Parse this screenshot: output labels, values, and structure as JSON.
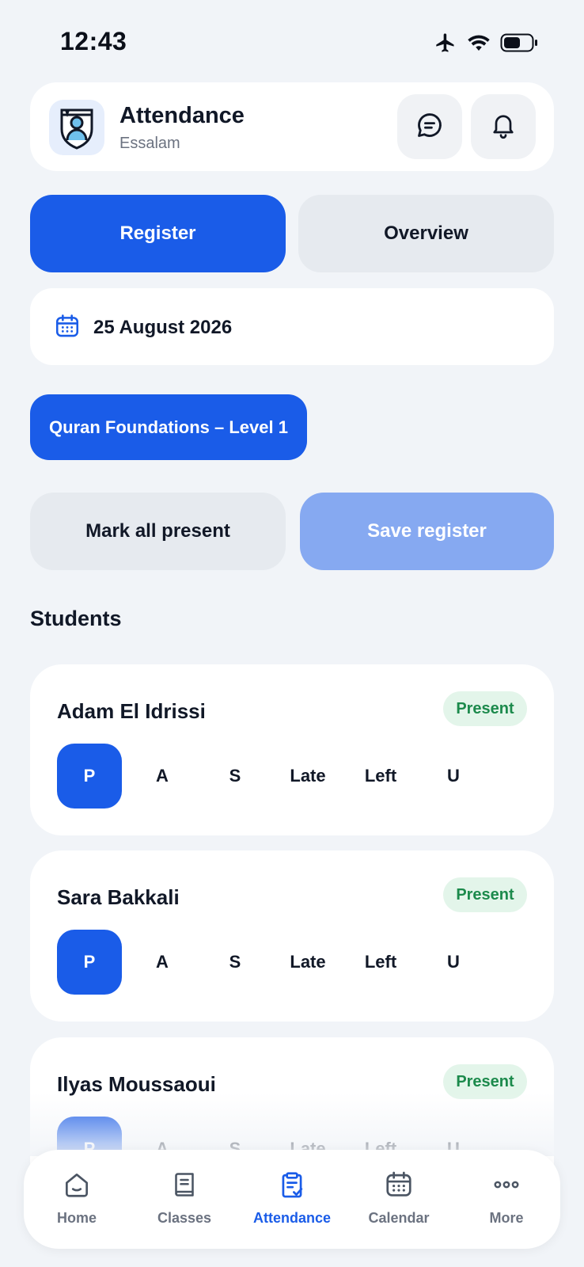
{
  "status_bar": {
    "time": "12:43"
  },
  "header": {
    "title": "Attendance",
    "subtitle": "Essalam"
  },
  "tabs": {
    "register": "Register",
    "overview": "Overview"
  },
  "date": {
    "label": "25 August 2026"
  },
  "class_chip": {
    "label": "Quran Foundations – Level 1"
  },
  "actions": {
    "mark_all": "Mark all present",
    "save": "Save register"
  },
  "section": {
    "title": "Students"
  },
  "attendance_options": [
    "P",
    "A",
    "S",
    "Late",
    "Left",
    "U"
  ],
  "students": [
    {
      "name": "Adam El Idrissi",
      "status": "Present",
      "selected": "P"
    },
    {
      "name": "Sara Bakkali",
      "status": "Present",
      "selected": "P"
    },
    {
      "name": "Ilyas Moussaoui",
      "status": "Present",
      "selected": "P"
    }
  ],
  "bottom_nav": [
    {
      "label": "Home",
      "icon": "home-icon"
    },
    {
      "label": "Classes",
      "icon": "book-icon"
    },
    {
      "label": "Attendance",
      "icon": "clipboard-check-icon",
      "active": true
    },
    {
      "label": "Calendar",
      "icon": "calendar-icon"
    },
    {
      "label": "More",
      "icon": "more-dots-icon"
    }
  ],
  "colors": {
    "accent": "#1a5ce8",
    "accent_disabled": "#86a9f1",
    "background": "#f1f4f8",
    "present_badge_bg": "#e3f5ea",
    "present_badge_text": "#1c8a4c"
  }
}
